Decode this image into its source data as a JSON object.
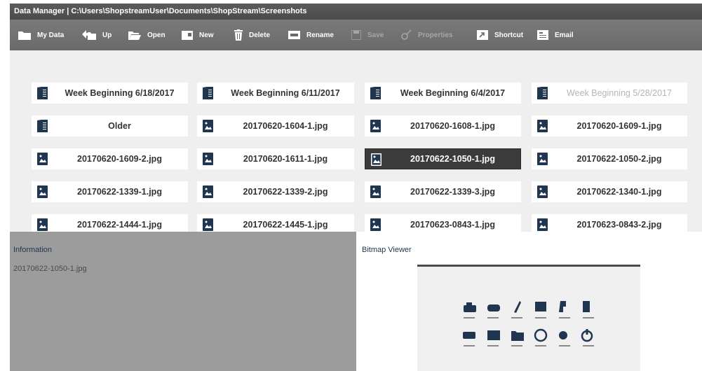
{
  "window": {
    "title": "Data Manager | C:\\Users\\ShopstreamUser\\Documents\\ShopStream\\Screenshots"
  },
  "toolbar": {
    "my_data": "My Data",
    "up": "Up",
    "open": "Open",
    "new": "New",
    "delete": "Delete",
    "rename": "Rename",
    "save": "Save",
    "properties": "Properties",
    "shortcut": "Shortcut",
    "email": "Email"
  },
  "files": [
    {
      "name": "Week Beginning  6/18/2017",
      "type": "folder"
    },
    {
      "name": "Week Beginning  6/11/2017",
      "type": "folder"
    },
    {
      "name": "Week Beginning  6/4/2017",
      "type": "folder"
    },
    {
      "name": "Week Beginning  5/28/2017",
      "type": "folder",
      "dimmed": true
    },
    {
      "name": "Older",
      "type": "folder"
    },
    {
      "name": "20170620-1604-1.jpg",
      "type": "image"
    },
    {
      "name": "20170620-1608-1.jpg",
      "type": "image"
    },
    {
      "name": "20170620-1609-1.jpg",
      "type": "image"
    },
    {
      "name": "20170620-1609-2.jpg",
      "type": "image"
    },
    {
      "name": "20170620-1611-1.jpg",
      "type": "image"
    },
    {
      "name": "20170622-1050-1.jpg",
      "type": "image",
      "selected": true
    },
    {
      "name": "20170622-1050-2.jpg",
      "type": "image"
    },
    {
      "name": "20170622-1339-1.jpg",
      "type": "image"
    },
    {
      "name": "20170622-1339-2.jpg",
      "type": "image"
    },
    {
      "name": "20170622-1339-3.jpg",
      "type": "image"
    },
    {
      "name": "20170622-1340-1.jpg",
      "type": "image"
    },
    {
      "name": "20170622-1444-1.jpg",
      "type": "image"
    },
    {
      "name": "20170622-1445-1.jpg",
      "type": "image"
    },
    {
      "name": "20170623-0843-1.jpg",
      "type": "image"
    },
    {
      "name": "20170623-0843-2.jpg",
      "type": "image"
    }
  ],
  "info": {
    "heading": "Information",
    "selected_file": "20170622-1050-1.jpg"
  },
  "viewer": {
    "heading": "Bitmap Viewer"
  },
  "colors": {
    "folder_icon": "#1f3550",
    "selected_bg": "#3b3b3b",
    "info_bg": "#9c9c9c"
  }
}
